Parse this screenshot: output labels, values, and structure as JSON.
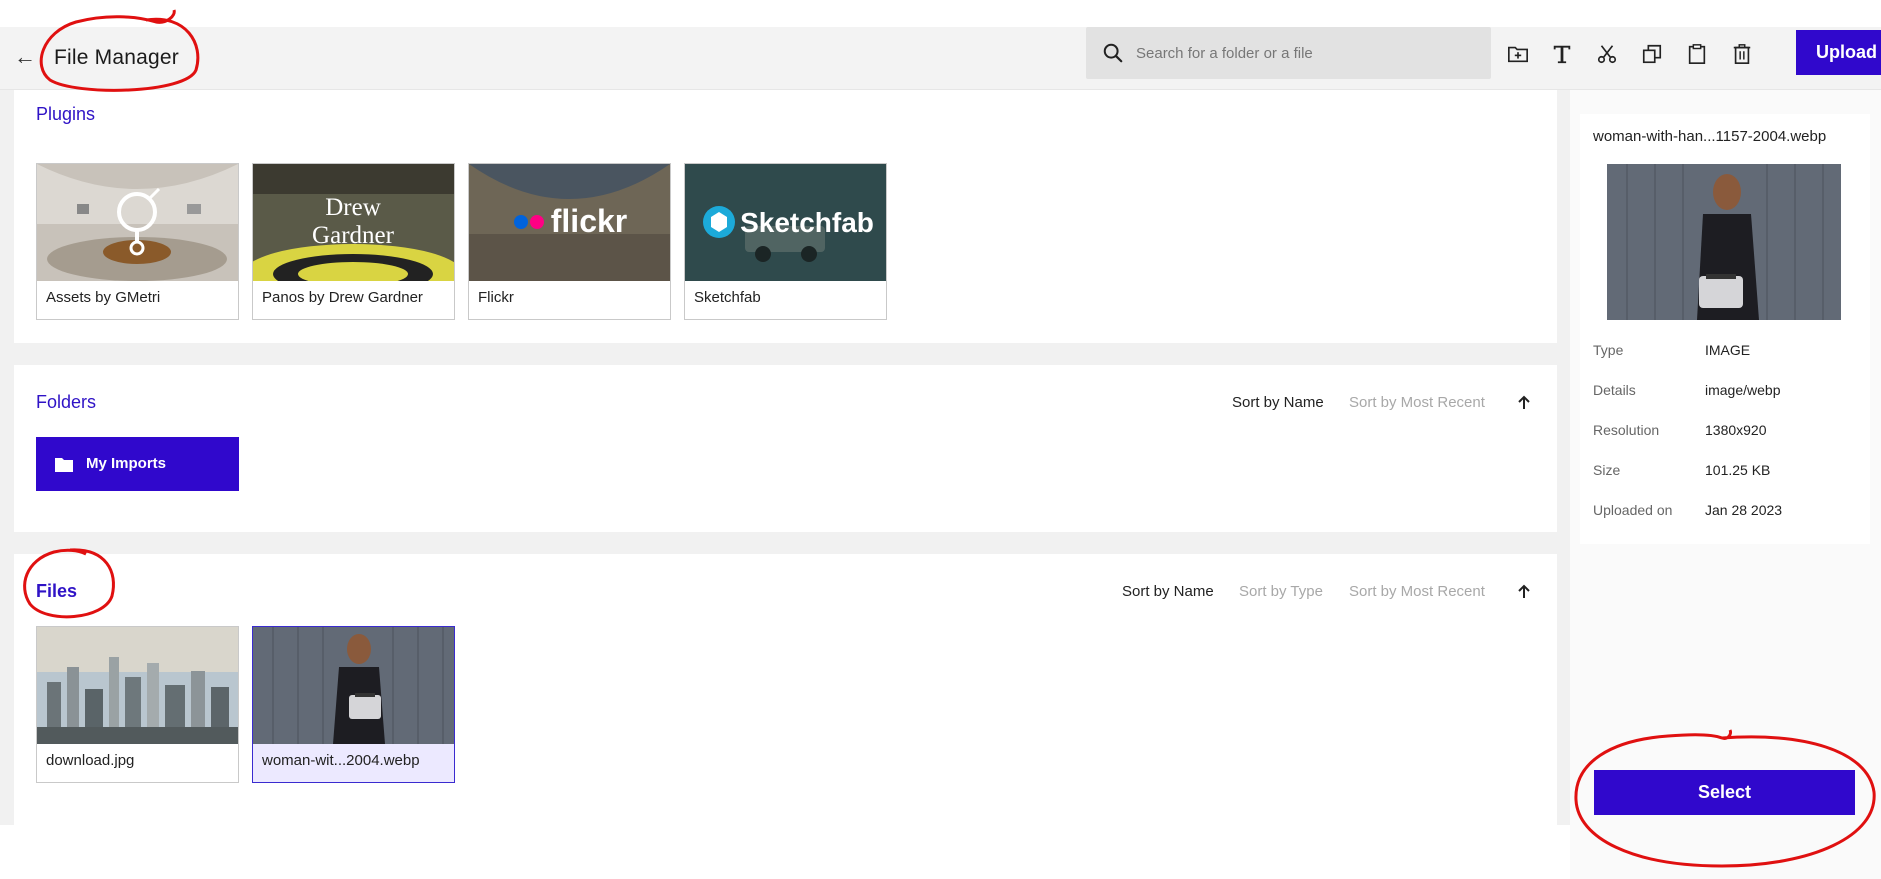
{
  "header": {
    "back_icon": "arrow-left-icon",
    "title": "File Manager",
    "search_placeholder": "Search for a folder or a file",
    "upload_label": "Upload",
    "tools": [
      "new-folder-icon",
      "rename-text-icon",
      "cut-icon",
      "copy-icon",
      "paste-icon",
      "delete-icon"
    ]
  },
  "plugins": {
    "title": "Plugins",
    "items": [
      {
        "label": "Assets by GMetri"
      },
      {
        "label": "Panos by Drew Gardner",
        "logo_text_1": "Drew",
        "logo_text_2": "Gardner"
      },
      {
        "label": "Flickr",
        "logo_text": "flickr"
      },
      {
        "label": "Sketchfab",
        "logo_text": "Sketchfab"
      }
    ]
  },
  "folders": {
    "title": "Folders",
    "sort": {
      "by_name": "Sort by Name",
      "by_recent": "Sort by Most Recent"
    },
    "items": [
      {
        "label": "My Imports"
      }
    ]
  },
  "files": {
    "title": "Files",
    "sort": {
      "by_name": "Sort by Name",
      "by_type": "Sort by Type",
      "by_recent": "Sort by Most Recent"
    },
    "items": [
      {
        "label": "download.jpg"
      },
      {
        "label": "woman-wit...2004.webp",
        "selected": true
      }
    ]
  },
  "details": {
    "filename": "woman-with-han...1157-2004.webp",
    "rows": [
      {
        "key": "Type",
        "value": "IMAGE"
      },
      {
        "key": "Details",
        "value": "image/webp"
      },
      {
        "key": "Resolution",
        "value": "1380x920"
      },
      {
        "key": "Size",
        "value": "101.25 KB"
      },
      {
        "key": "Uploaded on",
        "value": "Jan 28 2023"
      }
    ],
    "select_label": "Select"
  },
  "colors": {
    "accent": "#3008cc",
    "section_title": "#2f13c6",
    "annotation": "#e01010"
  }
}
